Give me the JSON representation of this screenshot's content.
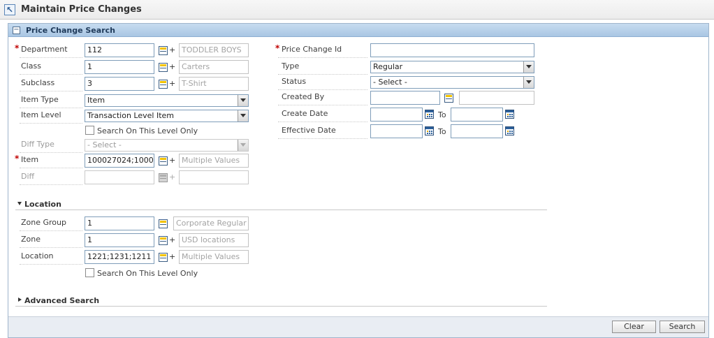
{
  "app": {
    "title": "Maintain Price Changes"
  },
  "panel": {
    "title": "Price Change Search"
  },
  "left": {
    "department": {
      "label": "Department",
      "value": "112",
      "desc": "TODDLER BOYS"
    },
    "class": {
      "label": "Class",
      "value": "1",
      "desc": "Carters"
    },
    "subclass": {
      "label": "Subclass",
      "value": "3",
      "desc": "T-Shirt"
    },
    "item_type": {
      "label": "Item Type",
      "value": "Item"
    },
    "item_level": {
      "label": "Item Level",
      "value": "Transaction Level Item"
    },
    "search_level_only": "Search On This Level Only",
    "diff_type": {
      "label": "Diff Type",
      "value": "- Select -"
    },
    "item": {
      "label": "Item",
      "value": "100027024;1000",
      "desc": "Multiple Values"
    },
    "diff": {
      "label": "Diff",
      "value": "",
      "desc": ""
    }
  },
  "right": {
    "price_change_id": {
      "label": "Price Change Id",
      "value": ""
    },
    "type": {
      "label": "Type",
      "value": "Regular"
    },
    "status": {
      "label": "Status",
      "value": "- Select -"
    },
    "created_by": {
      "label": "Created By",
      "value": "",
      "desc": ""
    },
    "create_date": {
      "label": "Create Date",
      "to": "To"
    },
    "effective_date": {
      "label": "Effective Date",
      "to": "To"
    }
  },
  "location": {
    "title": "Location",
    "zone_group": {
      "label": "Zone Group",
      "value": "1",
      "desc": "Corporate Regular"
    },
    "zone": {
      "label": "Zone",
      "value": "1",
      "desc": "USD locations"
    },
    "location": {
      "label": "Location",
      "value": "1221;1231;1211",
      "desc": "Multiple Values"
    },
    "search_level_only": "Search On This Level Only"
  },
  "advanced": {
    "title": "Advanced Search"
  },
  "buttons": {
    "clear": "Clear",
    "search": "Search"
  },
  "symbols": {
    "required": "*",
    "plus": "+",
    "collapse": "−",
    "back": "↖"
  },
  "colors": {
    "header_blue": "#a9c6e3",
    "required_red": "#c00000",
    "footer_bg": "#e9edf3"
  }
}
